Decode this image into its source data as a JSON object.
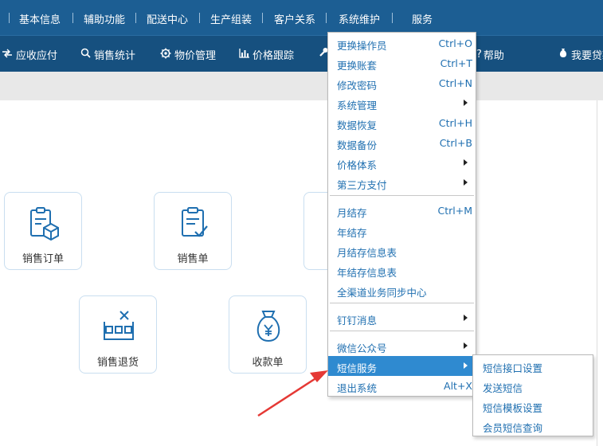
{
  "menubar": {
    "items": [
      "基本信息",
      "辅助功能",
      "配送中心",
      "生产组装",
      "客户关系",
      "系统维护",
      "服务"
    ]
  },
  "toolbar": {
    "items": [
      {
        "label": "应收应付",
        "icon": "transfer-arrows-icon",
        "glyph": "↔"
      },
      {
        "label": "销售统计",
        "icon": "search-icon",
        "glyph": "🔍"
      },
      {
        "label": "物价管理",
        "icon": "gear-icon",
        "glyph": "⚙"
      },
      {
        "label": "价格跟踪",
        "icon": "bar-chart-icon",
        "glyph": "▥"
      },
      {
        "label": "帮助",
        "icon": "help-icon",
        "glyph": "?"
      },
      {
        "label": "我要贷款",
        "icon": "money-bag-icon",
        "glyph": "💰"
      }
    ]
  },
  "tiles": [
    {
      "label": "销售订单",
      "icon": "sales-order-icon"
    },
    {
      "label": "销售单",
      "icon": "sales-slip-icon"
    },
    {
      "label": "销售退货",
      "icon": "sales-return-icon"
    },
    {
      "label": "收款单",
      "icon": "receipt-money-bag-icon"
    }
  ],
  "dropdown": {
    "items": [
      {
        "label": "更换操作员",
        "shortcut": "Ctrl+O"
      },
      {
        "label": "更换账套",
        "shortcut": "Ctrl+T"
      },
      {
        "label": "修改密码",
        "shortcut": "Ctrl+N"
      },
      {
        "label": "系统管理",
        "shortcut": ""
      },
      {
        "label": "数据恢复",
        "shortcut": "Ctrl+H"
      },
      {
        "label": "数据备份",
        "shortcut": "Ctrl+B"
      },
      {
        "label": "价格体系",
        "shortcut": ""
      },
      {
        "label": "第三方支付",
        "shortcut": ""
      },
      {
        "label": "月结存",
        "shortcut": "Ctrl+M"
      },
      {
        "label": "年结存",
        "shortcut": ""
      },
      {
        "label": "月结存信息表",
        "shortcut": ""
      },
      {
        "label": "年结存信息表",
        "shortcut": ""
      },
      {
        "label": "全渠道业务同步中心",
        "shortcut": ""
      },
      {
        "label": "钉钉消息",
        "shortcut": ""
      },
      {
        "label": "微信公众号",
        "shortcut": ""
      },
      {
        "label": "短信服务",
        "shortcut": ""
      },
      {
        "label": "退出系统",
        "shortcut": "Alt+X"
      }
    ]
  },
  "submenu": {
    "items": [
      "短信接口设置",
      "发送短信",
      "短信模板设置",
      "会员短信查询"
    ]
  },
  "colors": {
    "menubar_bg": "#1c5e93",
    "toolbar_bg": "#16507f",
    "menu_text": "#1f6fb0",
    "highlight": "#2f8ad0",
    "annotation_arrow": "#e53935"
  }
}
